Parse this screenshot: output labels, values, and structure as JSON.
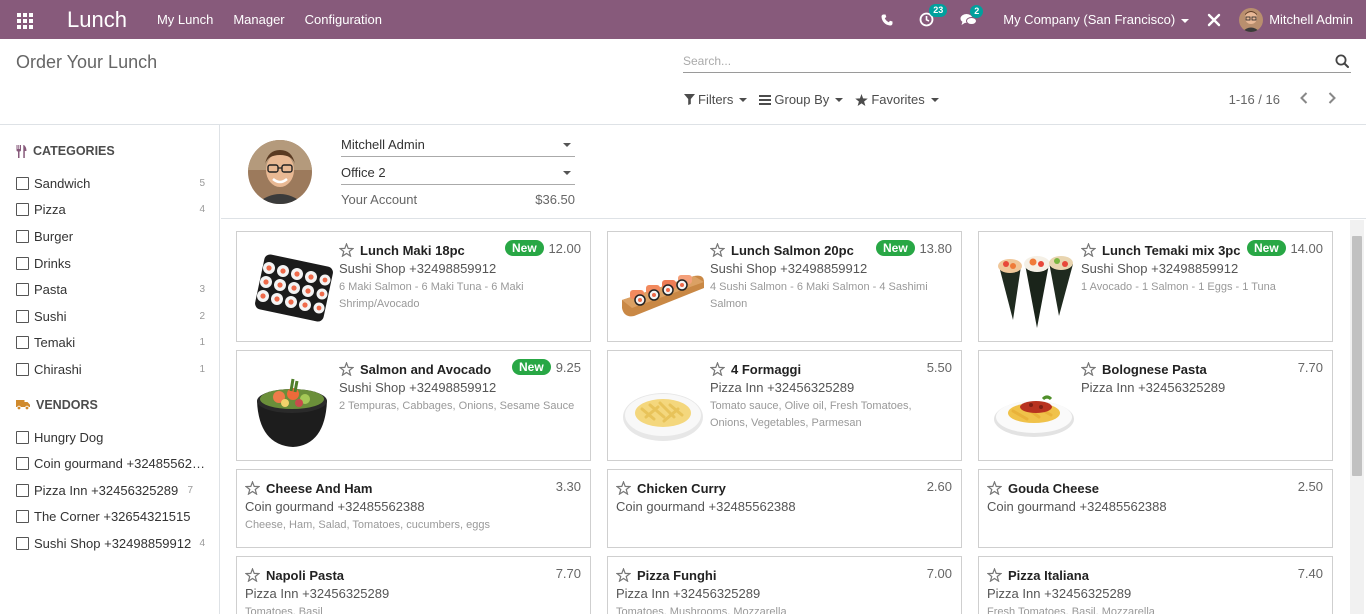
{
  "navbar": {
    "brand": "Lunch",
    "menu": [
      "My Lunch",
      "Manager",
      "Configuration"
    ],
    "activity_count": "23",
    "messages_count": "2",
    "company": "My Company (San Francisco)",
    "user": "Mitchell Admin",
    "bg_color": "#875a7b",
    "badge_color": "#00a09d"
  },
  "control_panel": {
    "title": "Order Your Lunch",
    "search_placeholder": "Search...",
    "filters_label": "Filters",
    "groupby_label": "Group By",
    "favorites_label": "Favorites",
    "pager": "1-16 / 16"
  },
  "sidebar": {
    "categories_title": "CATEGORIES",
    "categories": [
      {
        "label": "Sandwich",
        "count": "5"
      },
      {
        "label": "Pizza",
        "count": "4"
      },
      {
        "label": "Burger",
        "count": ""
      },
      {
        "label": "Drinks",
        "count": ""
      },
      {
        "label": "Pasta",
        "count": "3"
      },
      {
        "label": "Sushi",
        "count": "2"
      },
      {
        "label": "Temaki",
        "count": "1"
      },
      {
        "label": "Chirashi",
        "count": "1"
      }
    ],
    "vendors_title": "VENDORS",
    "vendors": [
      {
        "label": "Hungry Dog",
        "count": ""
      },
      {
        "label": "Coin gourmand +32485562388",
        "count": ""
      },
      {
        "label": "Pizza Inn +32456325289",
        "count": "7"
      },
      {
        "label": "The Corner +32654321515",
        "count": ""
      },
      {
        "label": "Sushi Shop +32498859912",
        "count": "4"
      }
    ]
  },
  "user_panel": {
    "user": "Mitchell Admin",
    "location": "Office 2",
    "account_label": "Your Account",
    "account_value": "$36.50"
  },
  "products": [
    {
      "name": "Lunch Maki 18pc",
      "new": "New",
      "price": "12.00",
      "vendor": "Sushi Shop +32498859912",
      "desc": "6 Maki Salmon - 6 Maki Tuna - 6 Maki Shrimp/Avocado",
      "image": "maki"
    },
    {
      "name": "Lunch Salmon 20pc",
      "new": "New",
      "price": "13.80",
      "vendor": "Sushi Shop +32498859912",
      "desc": "4 Sushi Salmon - 6 Maki Salmon - 4 Sashimi Salmon",
      "image": "salmon-board"
    },
    {
      "name": "Lunch Temaki mix 3pc",
      "new": "New",
      "price": "14.00",
      "vendor": "Sushi Shop +32498859912",
      "desc": "1 Avocado - 1 Salmon - 1 Eggs - 1 Tuna",
      "image": "temaki"
    },
    {
      "name": "Salmon and Avocado",
      "new": "New",
      "price": "9.25",
      "vendor": "Sushi Shop +32498859912",
      "desc": "2 Tempuras, Cabbages, Onions, Sesame Sauce",
      "image": "bowl"
    },
    {
      "name": "4 Formaggi",
      "new": "",
      "price": "5.50",
      "vendor": "Pizza Inn +32456325289",
      "desc": "Tomato sauce, Olive oil, Fresh Tomatoes, Onions, Vegetables, Parmesan",
      "image": "pasta-plate"
    },
    {
      "name": "Bolognese Pasta",
      "new": "",
      "price": "7.70",
      "vendor": "Pizza Inn +32456325289",
      "desc": "",
      "image": "bolognese"
    },
    {
      "name": "Cheese And Ham",
      "new": "",
      "price": "3.30",
      "vendor": "Coin gourmand +32485562388",
      "desc": "Cheese, Ham, Salad, Tomatoes, cucumbers, eggs",
      "image": ""
    },
    {
      "name": "Chicken Curry",
      "new": "",
      "price": "2.60",
      "vendor": "Coin gourmand +32485562388",
      "desc": "",
      "image": ""
    },
    {
      "name": "Gouda Cheese",
      "new": "",
      "price": "2.50",
      "vendor": "Coin gourmand +32485562388",
      "desc": "",
      "image": ""
    },
    {
      "name": "Napoli Pasta",
      "new": "",
      "price": "7.70",
      "vendor": "Pizza Inn +32456325289",
      "desc": "Tomatoes, Basil",
      "image": ""
    },
    {
      "name": "Pizza Funghi",
      "new": "",
      "price": "7.00",
      "vendor": "Pizza Inn +32456325289",
      "desc": "Tomatoes, Mushrooms, Mozzarella",
      "image": ""
    },
    {
      "name": "Pizza Italiana",
      "new": "",
      "price": "7.40",
      "vendor": "Pizza Inn +32456325289",
      "desc": "Fresh Tomatoes, Basil, Mozzarella",
      "image": ""
    }
  ]
}
